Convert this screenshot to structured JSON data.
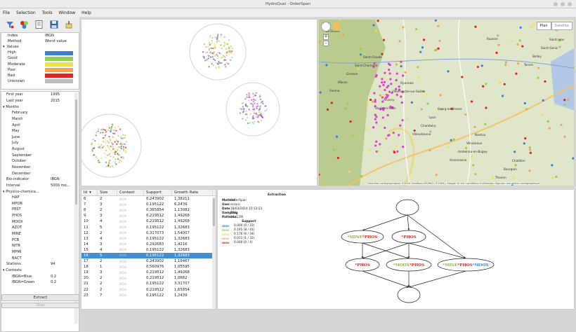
{
  "window": {
    "title": "HydroQual - OrderSpan"
  },
  "menu": [
    "File",
    "Selection",
    "Tools",
    "Window",
    "Help"
  ],
  "toolbar": {
    "icons": [
      "filter-icon",
      "color-balls-icon",
      "document-icon",
      "save-icon",
      "clean-icon"
    ]
  },
  "props": {
    "index_label": "Index",
    "index_value": "IBGN",
    "method_label": "Method",
    "method_value": "Worst value",
    "values_label": "Values",
    "values": [
      {
        "label": "High",
        "color": "#3a7fd6"
      },
      {
        "label": "Good",
        "color": "#8fd24b"
      },
      {
        "label": "Moderate",
        "color": "#ede24a"
      },
      {
        "label": "Poor",
        "color": "#f0a45a"
      },
      {
        "label": "Bad",
        "color": "#e2231f"
      },
      {
        "label": "Unknown",
        "color": "#bdbdbd"
      }
    ]
  },
  "tree": {
    "first_year": {
      "label": "First year",
      "value": "1995"
    },
    "last_year": {
      "label": "Last year",
      "value": "2015"
    },
    "months_label": "Months",
    "months": [
      "February",
      "March",
      "April",
      "May",
      "June",
      "July",
      "August",
      "September",
      "October",
      "November",
      "December"
    ],
    "bio_indicator": {
      "label": "Bio-indicator",
      "value": "IBGN"
    },
    "interval": {
      "label": "Interval",
      "value": "5000 mo..."
    },
    "physico_label": "Physico-chemica...",
    "physico": [
      "HAP",
      "MPOR",
      "PEST",
      "PHOS",
      "MOOX",
      "AZOT",
      "MINE",
      "PCB",
      "NITR",
      "MPMI",
      "BACT"
    ],
    "stations": {
      "label": "Stations",
      "value": "94"
    },
    "contexts_label": "Contexts",
    "contexts": [
      {
        "label": "IBGN=Blue",
        "value": "0.2"
      },
      {
        "label": "IBGN=Green",
        "value": "0.2"
      }
    ]
  },
  "buttons": {
    "extract": "Extract",
    "stop": "Stop"
  },
  "map": {
    "plan": "Plan",
    "satellite": "Satellite",
    "credit": "Données cartographiques ©2016 GeoBasis-DE/BKG (©2009), Google   10 km   Conditions d'utilisation   Signaler une erreur cartographique"
  },
  "map_places": [
    "Le Grand",
    "Saint-Claude",
    "Oyonnax",
    "Bourg-en-Bresse",
    "Nantua",
    "Chatillon",
    "Saint-Jean",
    "Saint-Chamond",
    "Villefranche-sur-Saône",
    "Lyon",
    "Vénissieux",
    "Bourgoin",
    "Saint-Genis",
    "Genève",
    "Annecy",
    "Chambéry",
    "Ambérieu-en-Bugey",
    "Thonon",
    "Belley",
    "Mâcon",
    "Vaulx-en-Velin",
    "Villeurbanne",
    "Annemasse",
    "Roanne",
    "Tarare",
    "Vienne"
  ],
  "table": {
    "columns": [
      "Id",
      "Size",
      "Context",
      "Support",
      "Growth Rate"
    ],
    "rows": [
      [
        "6",
        "2",
        "IBGN",
        "0,243902",
        "1,38211"
      ],
      [
        "7",
        "3",
        "IBGN",
        "0,195122",
        "6,2439"
      ],
      [
        "8",
        "2",
        "IBGN",
        "0,365854",
        "1,13082"
      ],
      [
        "9",
        "3",
        "IBGN",
        "0,219512",
        "1,49268"
      ],
      [
        "10",
        "4",
        "IBGN",
        "0,219512",
        "1,49268"
      ],
      [
        "11",
        "5",
        "IBGN",
        "0,195122",
        "1,32683"
      ],
      [
        "12",
        "2",
        "IBGN",
        "0,317073",
        "1,54007"
      ],
      [
        "13",
        "4",
        "IBGN",
        "0,195122",
        "1,32683"
      ],
      [
        "14",
        "3",
        "IBGN",
        "0,292683",
        "1,4216"
      ],
      [
        "15",
        "4",
        "IBGN",
        "0,195122",
        "1,32683"
      ],
      [
        "16",
        "5",
        "IBGN",
        "0,195122",
        "1,32683"
      ],
      [
        "17",
        "2",
        "IBGN",
        "0,243902",
        "1,18467"
      ],
      [
        "18",
        "1",
        "IBGN",
        "0,560976",
        "1,05595"
      ],
      [
        "19",
        "3",
        "IBGN",
        "0,219512",
        "1,49268"
      ],
      [
        "20",
        "2",
        "IBGN",
        "0,219512",
        "1,0662"
      ],
      [
        "21",
        "2",
        "IBGN",
        "0,195122",
        "3,31707"
      ],
      [
        "22",
        "2",
        "IBGN",
        "0,219512",
        "1,65854"
      ],
      [
        "23",
        "7",
        "IBGN",
        "0,195122",
        "1,2439"
      ]
    ],
    "selected_row": 10
  },
  "extraction": {
    "title": "Extraction",
    "method": {
      "label": "Method",
      "value": "OrderSpan"
    },
    "user": {
      "label": "User",
      "value": "ecroro"
    },
    "date": {
      "label": "Date",
      "value": "18/03/2014 15:12:21"
    },
    "sampling": {
      "label": "Sampling",
      "value": "133"
    },
    "patterns": {
      "label": "Patterns",
      "value": "16 (129)"
    },
    "support_label": "Support",
    "support": [
      {
        "label": "IBGN",
        "color": "#3a7fd6",
        "value": "0.000 (0 / 22)"
      },
      {
        "label": "IBGN",
        "color": "#8fd24b",
        "value": "0.195 (8 / 41)"
      },
      {
        "label": "IBGN",
        "color": "#ede24a",
        "value": "0.176 (6 / 34)"
      },
      {
        "label": "IBGN",
        "color": "#f0a45a",
        "value": "0.031 (1 / 32)"
      },
      {
        "label": "IBGN",
        "color": "#e2231f",
        "value": "0.000 (0 / 4)"
      }
    ]
  },
  "dag": {
    "n1": [
      {
        "t": "MINE",
        "c": "#8fae4a"
      },
      {
        "t": "PHOS",
        "c": "#e2231f"
      }
    ],
    "n2": [
      {
        "t": "PHOS",
        "c": "#e2231f"
      }
    ],
    "n3": [
      {
        "t": "PHOS",
        "c": "#e2231f"
      }
    ],
    "n4": [
      {
        "t": "MOOX",
        "c": "#8fae4a"
      },
      {
        "t": "PHOS",
        "c": "#e2231f"
      }
    ],
    "n5": [
      {
        "t": "MINE",
        "c": "#8fae4a"
      },
      {
        "t": "PHOS",
        "c": "#e2231f"
      },
      {
        "t": "MOOX",
        "c": "#3a7fd6"
      }
    ]
  }
}
